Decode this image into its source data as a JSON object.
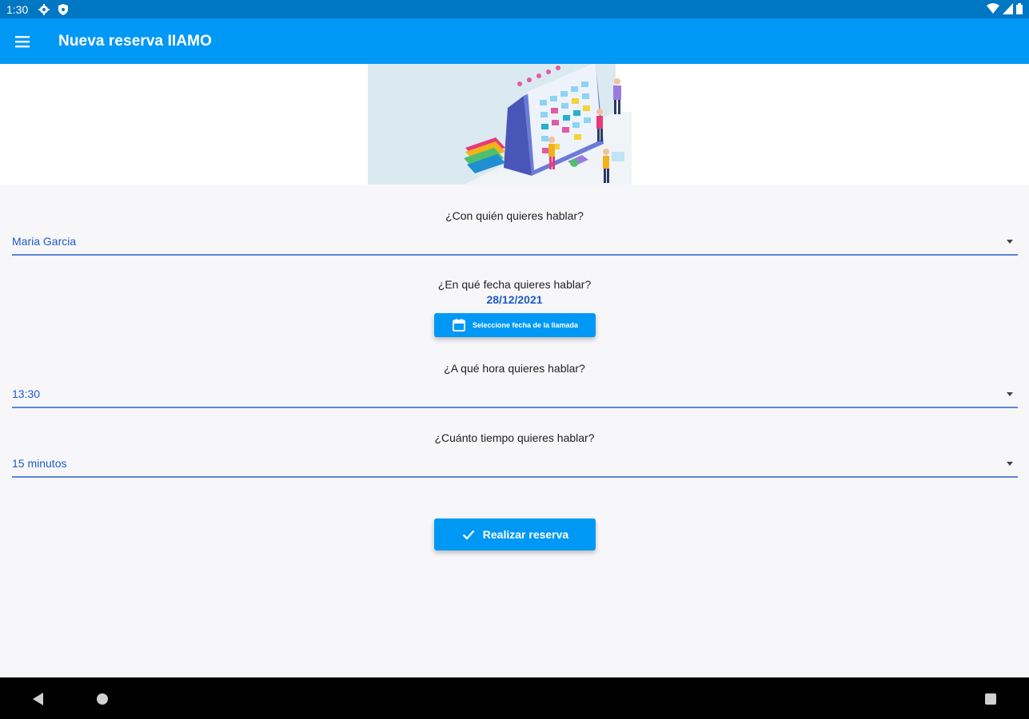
{
  "status_bar": {
    "time": "1:30"
  },
  "app_bar": {
    "title": "Nueva reserva IIAMO"
  },
  "form": {
    "contact": {
      "question": "¿Con quién quieres hablar?",
      "value": "Maria Garcia"
    },
    "date": {
      "question": "¿En qué fecha quieres hablar?",
      "value": "28/12/2021",
      "button_label": "Seleccione fecha de la llamada"
    },
    "time": {
      "question": "¿A qué hora quieres hablar?",
      "value": "13:30"
    },
    "duration": {
      "question": "¿Cuánto tiempo quieres hablar?",
      "value": "15 minutos"
    },
    "submit_label": "Realizar reserva"
  },
  "colors": {
    "primary": "#0098f5",
    "status_bar": "#0077c2",
    "accent_text": "#1e5bc6",
    "underline": "#5b86d4"
  },
  "icons": [
    "menu-icon",
    "settings-icon",
    "shield-icon",
    "wifi-icon",
    "signal-icon",
    "battery-icon",
    "calendar-icon",
    "check-icon",
    "back-icon",
    "home-icon",
    "recents-icon"
  ]
}
